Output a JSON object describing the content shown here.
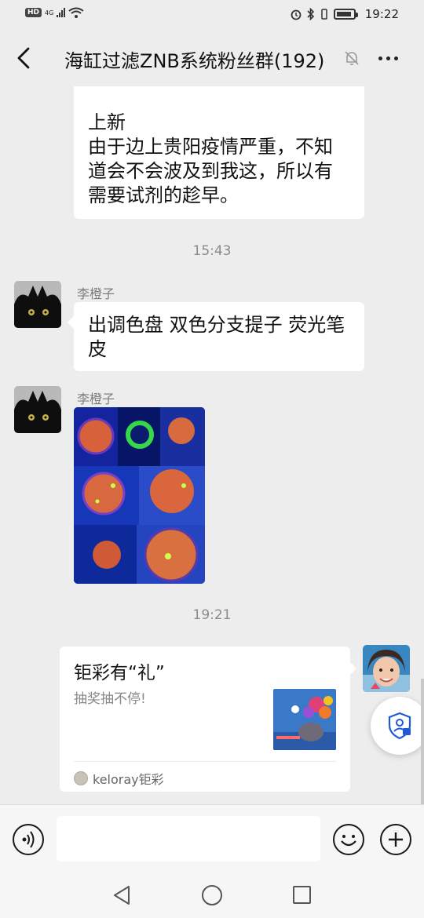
{
  "status_bar": {
    "hd_badge": "HD",
    "network": "4G",
    "time": "19:22"
  },
  "header": {
    "title": "海缸过滤ZNB系统粉丝群(192)"
  },
  "messages": {
    "first_bubble": {
      "line1": "上新",
      "line2": "由于边上贵阳疫情严重，不知",
      "line3": "道会不会波及到我这，所以有",
      "line4": "需要试剂的趁早。"
    },
    "time_1": "15:43",
    "msg2": {
      "sender": "李橙子",
      "line1": "出调色盘 双色分支提子 荧光笔",
      "line2": "皮"
    },
    "msg3": {
      "sender": "李橙子"
    },
    "time_2": "19:21",
    "card": {
      "title": "钜彩有“礼”",
      "desc": "抽奖抽不停!",
      "source": "keloray钜彩"
    }
  },
  "input": {
    "placeholder": ""
  },
  "colors": {
    "background": "#ededed",
    "bubble": "#ffffff",
    "accent_blue": "#1e5ad8"
  },
  "icons": [
    "back-icon",
    "mute-bell-icon",
    "more-icon",
    "voice-icon",
    "emoji-icon",
    "plus-icon",
    "shield-icon",
    "nav-back-icon",
    "nav-home-icon",
    "nav-recent-icon"
  ]
}
